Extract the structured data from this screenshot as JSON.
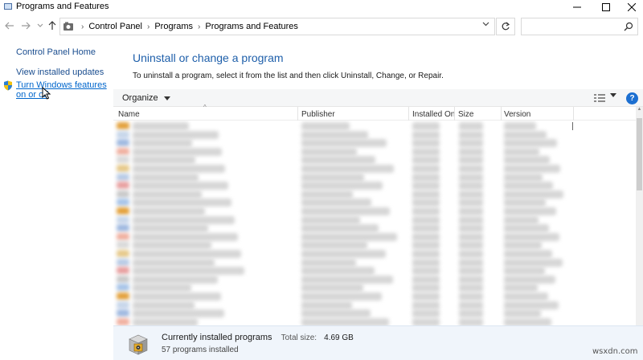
{
  "window": {
    "title": "Programs and Features"
  },
  "address_bar": {
    "crumbs": [
      "Control Panel",
      "Programs",
      "Programs and Features"
    ],
    "search_placeholder": ""
  },
  "left_pane": {
    "home_link": "Control Panel Home",
    "updates_link": "View installed updates",
    "features_link": "Turn Windows features on or off"
  },
  "main": {
    "heading": "Uninstall or change a program",
    "instruction": "To uninstall a program, select it from the list and then click Uninstall, Change, or Repair.",
    "organize_label": "Organize",
    "help_label": "?"
  },
  "columns": [
    "Name",
    "Publisher",
    "Installed On",
    "Size",
    "Version"
  ],
  "status": {
    "title": "Currently installed programs",
    "total_size_label": "Total size:",
    "total_size_value": "4.69 GB",
    "count_text": "57 programs installed"
  },
  "watermark": "wsxdn.com",
  "colors": {
    "link": "#1a4d8f",
    "heading": "#1e5faa",
    "help_icon": "#1c6fd1",
    "status_bg": "#f0f5fb"
  }
}
